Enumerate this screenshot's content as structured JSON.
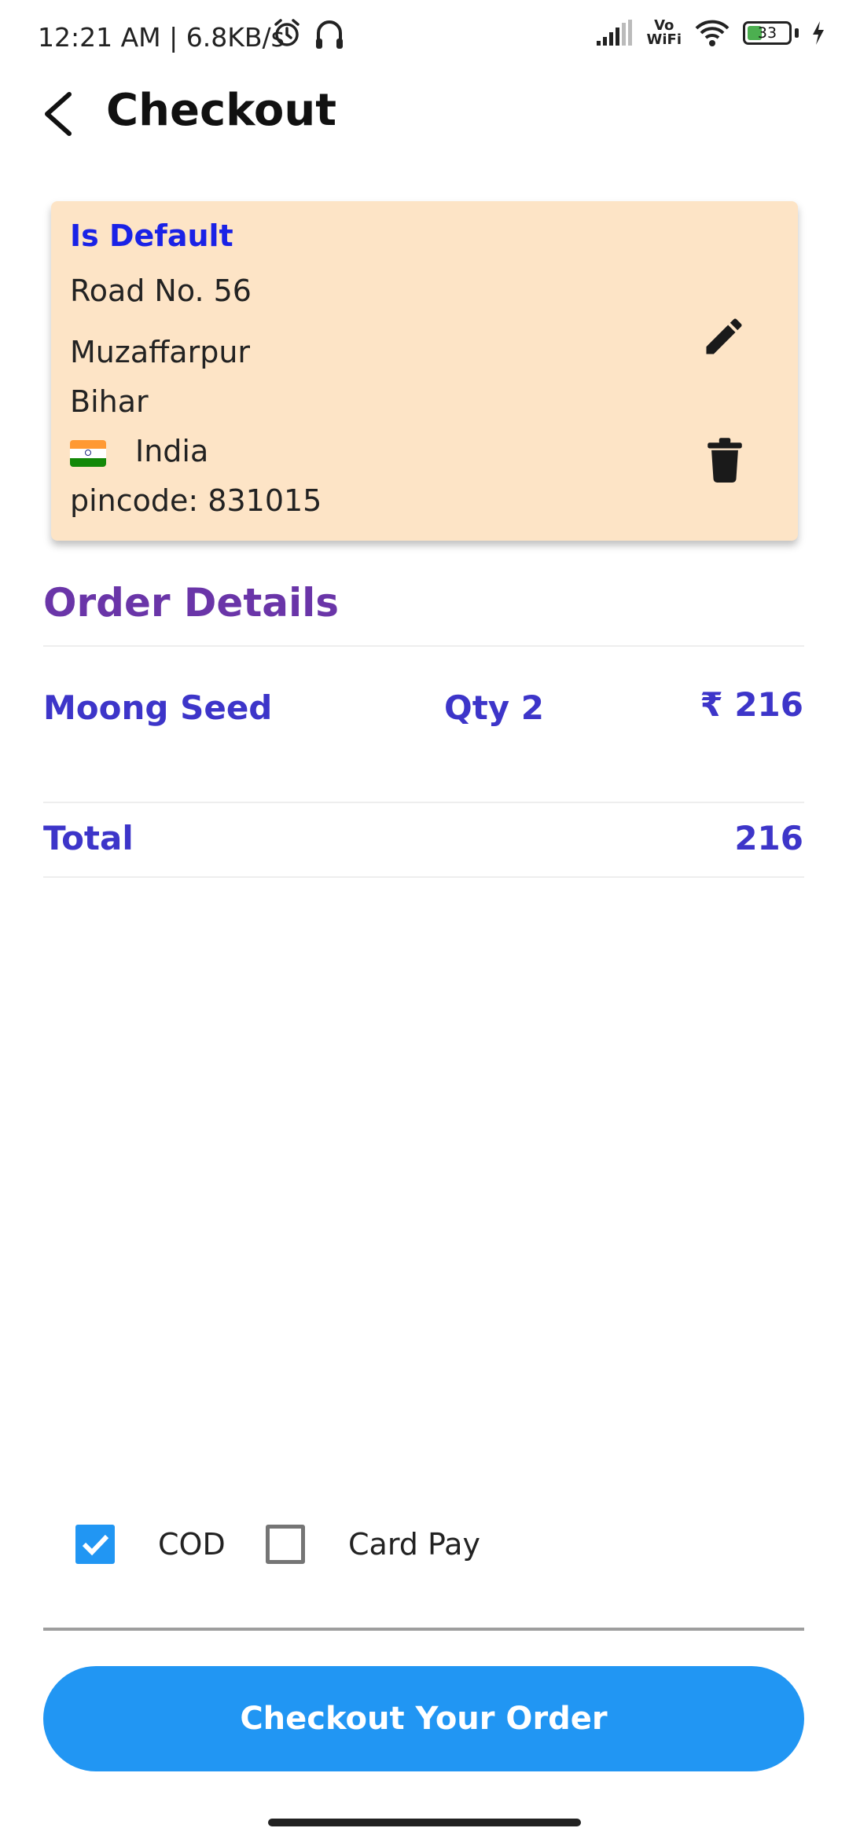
{
  "status_bar": {
    "time": "12:21 AM | 6.8KB/s",
    "vowifi_top": "Vo",
    "vowifi_bottom": "WiFi",
    "battery_level": "33"
  },
  "header": {
    "title": "Checkout"
  },
  "address": {
    "default_label": "Is Default",
    "line1": "Road No. 56",
    "city": "Muzaffarpur",
    "state": "Bihar",
    "country": "India",
    "pincode": "pincode: 831015"
  },
  "order": {
    "section_title": "Order Details",
    "items": [
      {
        "name": "Moong Seed",
        "qty": "Qty 2",
        "price": "₹ 216"
      }
    ],
    "total_label": "Total",
    "total_value": "216"
  },
  "payment": {
    "options": [
      {
        "label": "COD",
        "checked": true
      },
      {
        "label": "Card Pay",
        "checked": false
      }
    ]
  },
  "checkout_button_label": "Checkout Your Order",
  "colors": {
    "accent": "#2196f3",
    "address_card": "#fde4c6",
    "section_title": "#6a35a8",
    "order_text": "#3d35c9",
    "default_label": "#1a22e6"
  }
}
